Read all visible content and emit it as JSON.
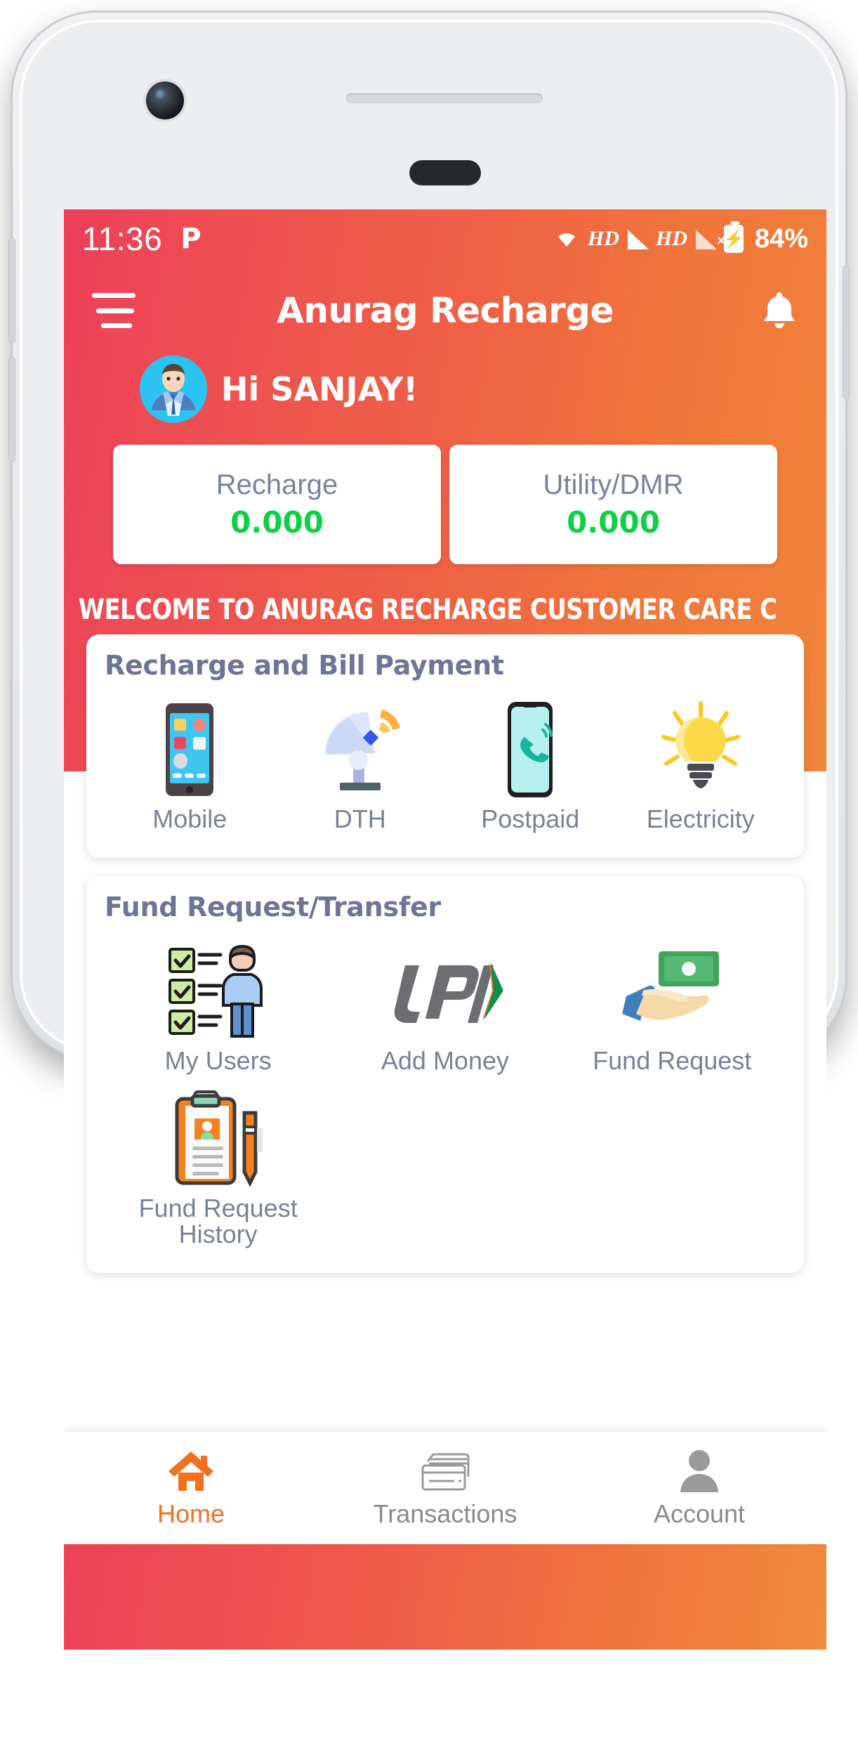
{
  "status_bar": {
    "time": "11:36",
    "left_icon": "paytm-p-icon",
    "hd_label_1": "HD",
    "hd_label_2": "HD",
    "battery_percent": "84%",
    "icons": [
      "wifi-icon",
      "hd-badge",
      "signal-bar-icon",
      "hd-badge",
      "signal-bar-off-icon",
      "battery-charging-icon"
    ]
  },
  "app_bar": {
    "menu_icon": "hamburger-menu-icon",
    "title": "Anurag Recharge",
    "notification_icon": "bell-icon"
  },
  "greeting": {
    "avatar_icon": "user-avatar-businessman",
    "text": "Hi SANJAY!"
  },
  "balances": [
    {
      "label": "Recharge",
      "value": "0.000"
    },
    {
      "label": "Utility/DMR",
      "value": "0.000"
    }
  ],
  "marquee": {
    "text": "WELCOME TO ANURAG RECHARGE CUSTOMER CARE C"
  },
  "sections": [
    {
      "title": "Recharge and Bill Payment",
      "columns": 4,
      "items": [
        {
          "label": "Mobile",
          "icon": "mobile-phone-icon"
        },
        {
          "label": "DTH",
          "icon": "satellite-dish-icon"
        },
        {
          "label": "Postpaid",
          "icon": "postpaid-phone-icon"
        },
        {
          "label": "Electricity",
          "icon": "light-bulb-icon"
        }
      ]
    },
    {
      "title": "Fund Request/Transfer",
      "columns": 3,
      "items": [
        {
          "label": "My Users",
          "icon": "my-users-checklist-icon"
        },
        {
          "label": "Add Money",
          "icon": "upi-logo-icon"
        },
        {
          "label": "Fund Request",
          "icon": "cash-in-hand-icon"
        },
        {
          "label": "Fund Request History",
          "icon": "clipboard-pen-icon"
        }
      ]
    }
  ],
  "bottom_nav": [
    {
      "label": "Home",
      "icon": "home-icon",
      "active": true
    },
    {
      "label": "Transactions",
      "icon": "transactions-cards-icon",
      "active": false
    },
    {
      "label": "Account",
      "icon": "account-person-icon",
      "active": false
    }
  ],
  "colors": {
    "gradient_start": "#ed3f5c",
    "gradient_end": "#f1853b",
    "balance_value_green": "#0fcf45",
    "title_gray_blue": "#6e7596",
    "active_orange": "#f4701f",
    "label_gray": "#7a8099"
  }
}
